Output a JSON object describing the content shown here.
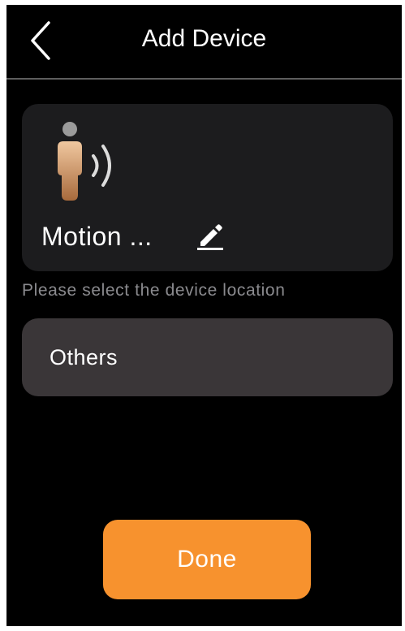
{
  "header": {
    "back_icon": "chevron-left-icon",
    "title": "Add Device"
  },
  "device": {
    "icon": "motion-sensor-icon",
    "name": "Motion ...",
    "edit_icon": "pencil-icon"
  },
  "location": {
    "hint": "Please select the device location",
    "selected": "Others"
  },
  "actions": {
    "done_label": "Done"
  },
  "colors": {
    "background": "#000000",
    "card": "#1c1c1e",
    "select": "#3a3638",
    "accent": "#f7922e",
    "hint_text": "#8a8a8e",
    "divider": "#5e5e5e"
  }
}
